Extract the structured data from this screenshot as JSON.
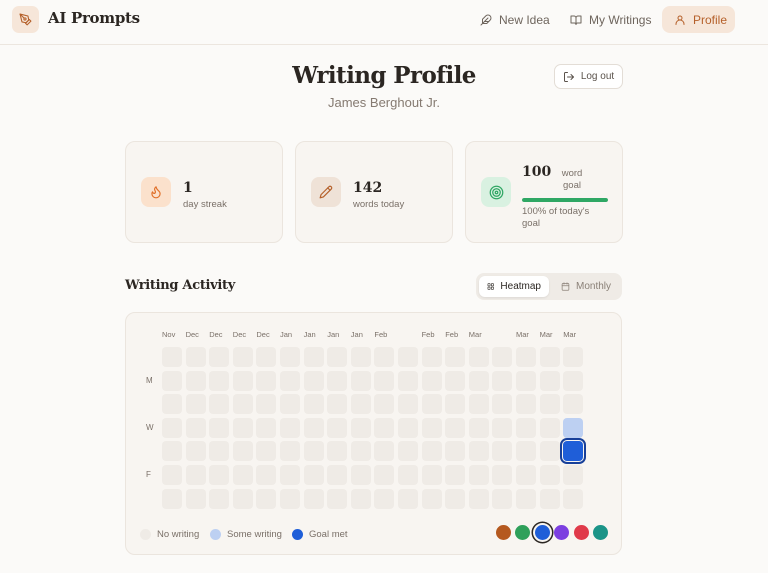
{
  "app": {
    "title": "AI Prompts",
    "logo_icon": "pen-nib-icon"
  },
  "nav": {
    "items": [
      {
        "label": "New Idea",
        "icon": "feather-icon"
      },
      {
        "label": "My Writings",
        "icon": "book-open-icon"
      },
      {
        "label": "Profile",
        "icon": "user-icon",
        "active": true
      }
    ]
  },
  "profile": {
    "title": "Writing Profile",
    "name": "James Berghout Jr.",
    "logout_label": "Log out"
  },
  "stats": {
    "streak": {
      "value": "1",
      "label": "day streak",
      "icon": "flame-icon"
    },
    "words": {
      "value": "142",
      "label": "words today",
      "icon": "pencil-icon"
    },
    "goal": {
      "value": "100",
      "unit": "word goal",
      "caption": "100% of today's goal",
      "progress": 1.0,
      "icon": "target-icon"
    }
  },
  "activity": {
    "title": "Writing Activity",
    "view_options": [
      "Heatmap",
      "Monthly"
    ],
    "selected_view": "Heatmap",
    "month_labels": [
      "Nov",
      "Dec",
      "Dec",
      "Dec",
      "Dec",
      "Jan",
      "Jan",
      "Jan",
      "Jan",
      "Feb",
      "",
      "Feb",
      "Feb",
      "Mar",
      "",
      "Mar",
      "Mar",
      "Mar"
    ],
    "day_labels": [
      "",
      "M",
      "",
      "W",
      "",
      "F",
      ""
    ],
    "weeks": 18,
    "days": 7,
    "active_cells": [
      {
        "week": 17,
        "day": 3,
        "level": "some"
      },
      {
        "week": 17,
        "day": 4,
        "level": "goal"
      }
    ],
    "legend": [
      {
        "label": "No writing",
        "color": "#efebe6"
      },
      {
        "label": "Some writing",
        "color": "#bdd0f2"
      },
      {
        "label": "Goal met",
        "color": "#1f5ed8"
      }
    ],
    "color_options": [
      "#b5591f",
      "#2fa05a",
      "#1f5ed8",
      "#7c3fe0",
      "#e03a4a",
      "#1b9488"
    ],
    "selected_color": "#1f5ed8"
  },
  "colors": {
    "accent": "#b5602a",
    "goal_green": "#2fa764",
    "background": "#fbfaf8"
  }
}
